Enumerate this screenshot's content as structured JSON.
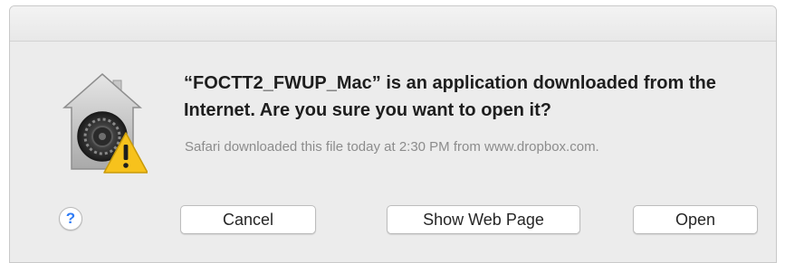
{
  "dialog": {
    "headline": "“FOCTT2_FWUP_Mac” is an application downloaded from the Internet. Are you sure you want to open it?",
    "info": "Safari downloaded this file today at 2:30 PM from www.dropbox.com.",
    "icon": "gatekeeper-warning-icon",
    "help_label": "?",
    "buttons": {
      "cancel": "Cancel",
      "show_web_page": "Show Web Page",
      "open": "Open"
    }
  },
  "colors": {
    "dialog_bg": "#ececec",
    "help_accent": "#2f7cf6",
    "warning_yellow": "#f7c21c"
  }
}
